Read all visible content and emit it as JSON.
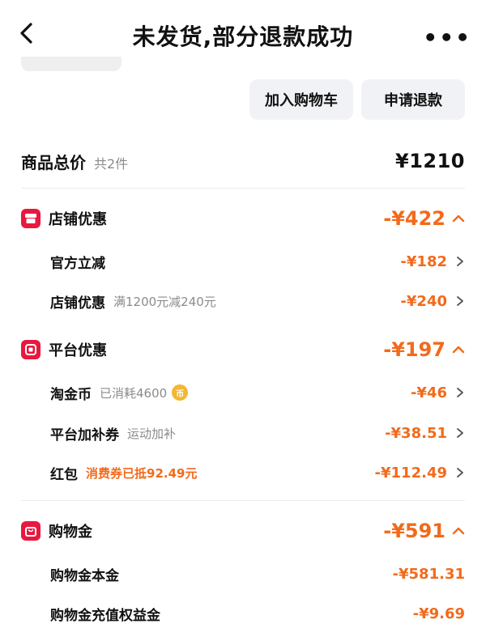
{
  "header": {
    "title": "未发货,部分退款成功",
    "more_label": "•••"
  },
  "actions": {
    "add_to_cart": "加入购物车",
    "refund": "申请退款"
  },
  "total": {
    "label": "商品总价",
    "count": "共2件",
    "amount": "¥1210"
  },
  "sections": [
    {
      "name": "店铺优惠",
      "value": "-¥422",
      "icon": "store-icon",
      "rows": [
        {
          "name": "官方立减",
          "sub": "",
          "value": "-¥182"
        },
        {
          "name": "店铺优惠",
          "sub": "满1200元减240元",
          "value": "-¥240"
        }
      ]
    },
    {
      "name": "平台优惠",
      "value": "-¥197",
      "icon": "platform-icon",
      "rows": [
        {
          "name": "淘金币",
          "sub": "已消耗4600",
          "coin_glyph": "币",
          "value": "-¥46"
        },
        {
          "name": "平台加补券",
          "sub": "运动加补",
          "value": "-¥38.51"
        },
        {
          "name": "红包",
          "sub": "消费券已抵92.49元",
          "value": "-¥112.49"
        }
      ]
    },
    {
      "name": "购物金",
      "value": "-¥591",
      "icon": "shopping-bag-icon",
      "rows": [
        {
          "name": "购物金本金",
          "sub": "",
          "value": "-¥581.31"
        },
        {
          "name": "购物金充值权益金",
          "sub": "",
          "value": "-¥9.69"
        }
      ]
    }
  ],
  "colors": {
    "accent": "#f26a1b",
    "badge": "#e8183f",
    "button_bg": "#f1f2f6",
    "muted": "#8b8b8b"
  }
}
